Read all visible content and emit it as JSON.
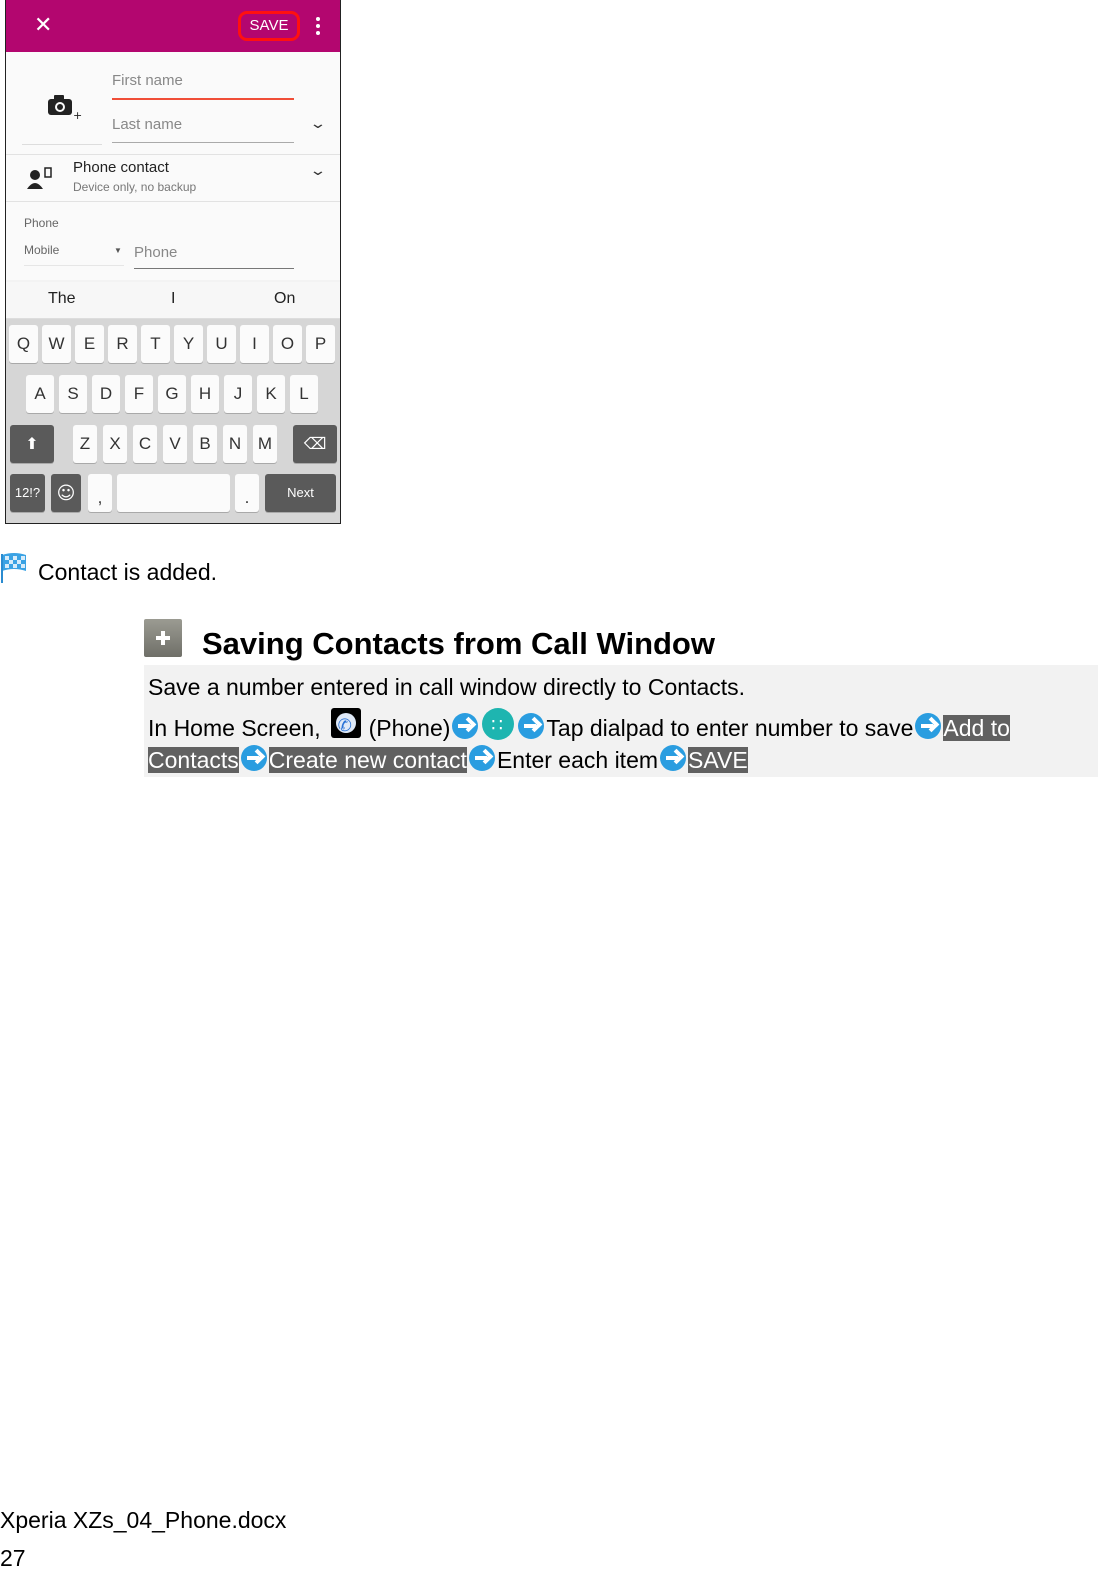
{
  "screenshot": {
    "toolbar": {
      "close_icon": "close-icon",
      "save_label": "SAVE",
      "menu_icon": "more-vert-icon",
      "accent_color": "#b3066f",
      "highlight_color": "#ff1010"
    },
    "name": {
      "photo_icon": "add-photo-icon",
      "first_name_placeholder": "First name",
      "last_name_placeholder": "Last name"
    },
    "account": {
      "title": "Phone contact",
      "subtitle": "Device only, no backup"
    },
    "phone": {
      "label": "Phone",
      "type": "Mobile",
      "placeholder": "Phone"
    },
    "suggestions": [
      "The",
      "I",
      "On"
    ],
    "keyboard": {
      "row1": [
        "Q",
        "W",
        "E",
        "R",
        "T",
        "Y",
        "U",
        "I",
        "O",
        "P"
      ],
      "row2": [
        "A",
        "S",
        "D",
        "F",
        "G",
        "H",
        "J",
        "K",
        "L"
      ],
      "row3": [
        "Z",
        "X",
        "C",
        "V",
        "B",
        "N",
        "M"
      ],
      "symbols_label": "12!?",
      "comma": ",",
      "period": ".",
      "period_alt": "?!",
      "next_label": "Next"
    }
  },
  "result_text": "Contact is added.",
  "section": {
    "title": "Saving Contacts from Call Window",
    "description": "Save a number entered in call window directly to Contacts.",
    "steps": {
      "prefix": "In Home Screen,",
      "phone_label": "(Phone)",
      "tap_dialpad": "Tap dialpad to enter number to save",
      "add_to_contacts_1": "Add to",
      "add_to_contacts_2": "Contacts",
      "create_new": "Create new contact",
      "enter_each": "Enter each item",
      "save": "SAVE"
    }
  },
  "footer": {
    "filename": "Xperia XZs_04_Phone.docx",
    "page": "27"
  }
}
